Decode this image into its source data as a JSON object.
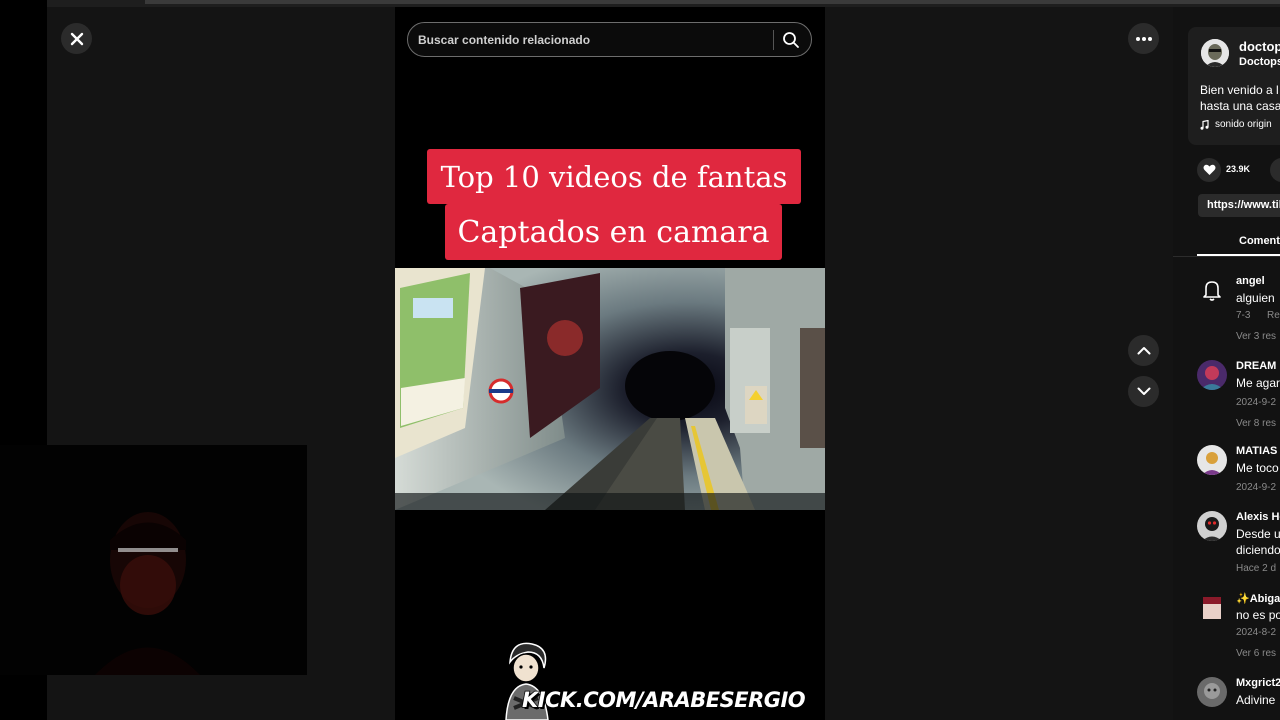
{
  "search": {
    "placeholder": "Buscar contenido relacionado"
  },
  "caption": {
    "line1": "Top 10 videos de fantas",
    "line2": "Captados en camara"
  },
  "stream": {
    "url": "KICK.COM/ARABESERGIO"
  },
  "post": {
    "author_name": "doctop",
    "author_handle": "Doctops",
    "desc_line1": "Bien venido a l",
    "desc_line2": "hasta una casa",
    "sound": "sonido origin",
    "likes": "23.9K",
    "link": "https://www.tik"
  },
  "tabs": {
    "comments": "Coment"
  },
  "comments": [
    {
      "user": "angel",
      "text": "alguien",
      "date": "7-3",
      "reply": "Re",
      "more": "Ver 3 res"
    },
    {
      "user": "DREAM",
      "text": "Me agar",
      "date": "2024-9-2",
      "more": "Ver 8 res"
    },
    {
      "user": "MATIAS",
      "text": "Me toco",
      "date": "2024-9-2"
    },
    {
      "user": "Alexis He",
      "text": "Desde u",
      "text2": "diciendo",
      "date": "Hace 2 d"
    },
    {
      "user": "✨Abiga",
      "text": "no es po",
      "date": "2024-8-2",
      "more": "Ver 6 res"
    },
    {
      "user": "Mxgrict2",
      "text": "Adivine"
    }
  ],
  "icons": {
    "close": "close-icon",
    "more": "more-horizontal-icon",
    "search": "search-icon",
    "up": "chevron-up-icon",
    "down": "chevron-down-icon",
    "like": "heart-icon",
    "music": "music-note-icon",
    "bell": "bell-icon"
  },
  "colors": {
    "caption_bg": "#e0283f",
    "heart": "#e0245e"
  }
}
